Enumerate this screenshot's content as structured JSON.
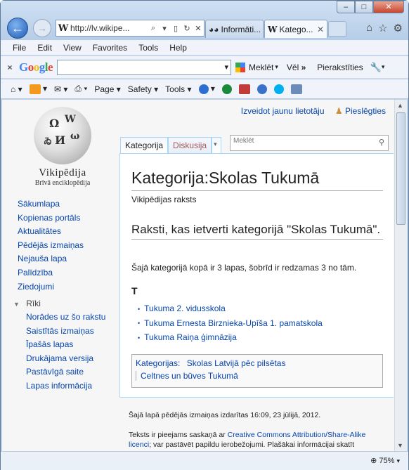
{
  "browser": {
    "address_url": "http://lv.wikipe...",
    "address_icon": "W",
    "tabs": [
      {
        "label": "Informāti...",
        "icon": "eyes-icon"
      },
      {
        "label": "Katego...",
        "icon": "W"
      }
    ],
    "caption_buttons": {
      "minimize": "–",
      "maximize": "□",
      "close": "✕"
    }
  },
  "menu": [
    "File",
    "Edit",
    "View",
    "Favorites",
    "Tools",
    "Help"
  ],
  "google_bar": {
    "logo": "Google",
    "search_label": "Meklēt",
    "more_label": "Vēl",
    "signin_label": "Pierakstīties"
  },
  "command_bar": {
    "page_label": "Page",
    "safety_label": "Safety",
    "tools_label": "Tools"
  },
  "wiki": {
    "create_account": "Izveidot jaunu lietotāju",
    "login": "Pieslēgties",
    "logo_name": "Vikipēdija",
    "logo_tagline": "Brīvā enciklopēdija",
    "nav": [
      "Sākumlapa",
      "Kopienas portāls",
      "Aktualitātes",
      "Pēdējās izmaiņas",
      "Nejauša lapa",
      "Palīdzība",
      "Ziedojumi"
    ],
    "tools_heading": "Rīki",
    "tools": [
      "Norādes uz šo rakstu",
      "Saistītās izmaiņas",
      "Īpašās lapas",
      "Drukājama versija",
      "Pastāvīgā saite",
      "Lapas informācija"
    ],
    "tab_category": "Kategorija",
    "tab_discussion": "Diskusija",
    "search_placeholder": "Meklēt",
    "title": "Kategorija:Skolas Tukumā",
    "subtitle": "Vikipēdijas raksts",
    "section_heading": "Raksti, kas ietverti kategorijā \"Skolas Tukumā\".",
    "count_text": "Šajā kategorijā kopā ir 3 lapas, šobrīd ir redzamas 3 no tām.",
    "letter": "T",
    "pages": [
      "Tukuma 2. vidusskola",
      "Tukuma Ernesta Birznieka-Upīša 1. pamatskola",
      "Tukuma Raiņa ģimnāzija"
    ],
    "categories_label": "Kategorijas:",
    "categories": [
      "Skolas Latvijā pēc pilsētas",
      "Celtnes un būves Tukumā"
    ],
    "footer_modified": "Šajā lapā pēdējās izmaiņas izdarītas 16:09, 23 jūlijā, 2012.",
    "footer_license_prefix": "Teksts ir pieejams saskaņā ar ",
    "footer_license_link": "Creative Commons Attribution/Share-Alike licenci",
    "footer_license_suffix": "; var pastāvēt papildu ierobežojumi. Plašākai informācijai skatīt"
  },
  "status_bar": {
    "zoom": "75%"
  }
}
